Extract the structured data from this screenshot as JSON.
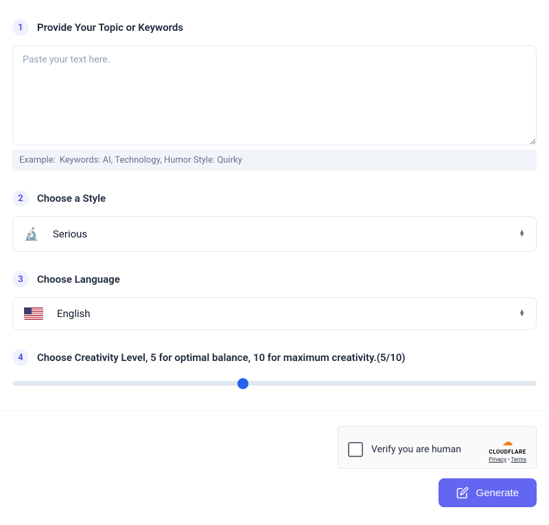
{
  "steps": [
    {
      "num": "1",
      "title": "Provide Your Topic or Keywords",
      "placeholder": "Paste your text here.",
      "example_label": "Example:",
      "example_text": "Keywords: AI, Technology, Humor Style: Quirky"
    },
    {
      "num": "2",
      "title": "Choose a Style",
      "selected": "Serious",
      "avatar": "🔬"
    },
    {
      "num": "3",
      "title": "Choose Language",
      "selected": "English"
    },
    {
      "num": "4",
      "title": "Choose Creativity Level, 5 for optimal balance, 10 for maximum creativity.(5/10)",
      "slider": {
        "min": 0,
        "max": 10,
        "value": 5
      }
    }
  ],
  "captcha": {
    "label": "Verify you are human",
    "brand": "CLOUDFLARE",
    "privacy": "Privacy",
    "terms": "Terms"
  },
  "generate_label": "Generate"
}
